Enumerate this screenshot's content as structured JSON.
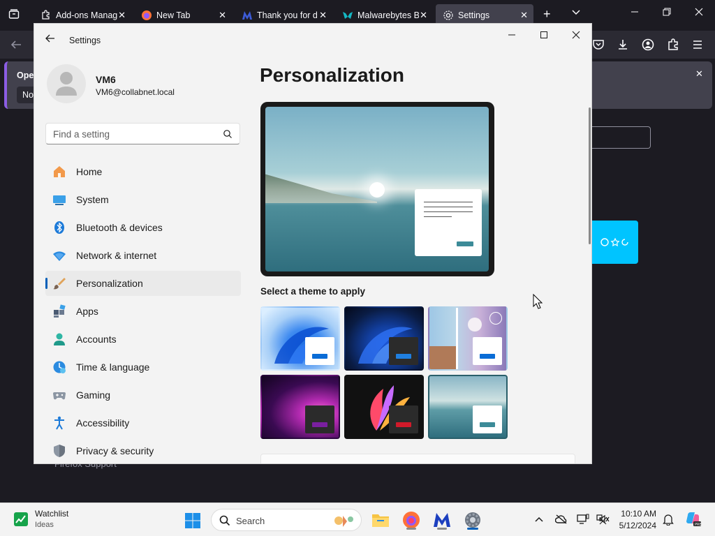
{
  "firefox": {
    "tabs": [
      {
        "label": "Add-ons Manager",
        "icon": "puzzle-icon"
      },
      {
        "label": "New Tab",
        "icon": "firefox-icon"
      },
      {
        "label": "Thank you for d",
        "icon": "malwarebytes-icon"
      },
      {
        "label": "Malwarebytes B",
        "icon": "malwarebytes-teal-icon"
      },
      {
        "label": "Settings",
        "icon": "gear-icon"
      }
    ],
    "notification_label": "Oper",
    "notification_button": "No",
    "support_link": "Firefox Support"
  },
  "settings": {
    "app_title": "Settings",
    "profile": {
      "name": "VM6",
      "email": "VM6@collabnet.local"
    },
    "search_placeholder": "Find a setting",
    "nav": [
      {
        "label": "Home",
        "icon": "home-icon"
      },
      {
        "label": "System",
        "icon": "system-icon"
      },
      {
        "label": "Bluetooth & devices",
        "icon": "bluetooth-icon"
      },
      {
        "label": "Network & internet",
        "icon": "network-icon"
      },
      {
        "label": "Personalization",
        "icon": "brush-icon",
        "selected": true
      },
      {
        "label": "Apps",
        "icon": "apps-icon"
      },
      {
        "label": "Accounts",
        "icon": "accounts-icon"
      },
      {
        "label": "Time & language",
        "icon": "time-icon"
      },
      {
        "label": "Gaming",
        "icon": "gaming-icon"
      },
      {
        "label": "Accessibility",
        "icon": "accessibility-icon"
      },
      {
        "label": "Privacy & security",
        "icon": "shield-icon"
      }
    ],
    "page_title": "Personalization",
    "theme_section_label": "Select a theme to apply",
    "themes": [
      {
        "name": "windows-light",
        "selected": false
      },
      {
        "name": "windows-dark",
        "selected": false
      },
      {
        "name": "windows-spotlight",
        "selected": false
      },
      {
        "name": "glow",
        "selected": false
      },
      {
        "name": "captured-motion",
        "selected": false
      },
      {
        "name": "flow",
        "selected": true
      }
    ]
  },
  "taskbar": {
    "widget_title": "Watchlist",
    "widget_sub": "Ideas",
    "search_placeholder": "Search",
    "time": "10:10 AM",
    "date": "5/12/2024"
  },
  "colors": {
    "accent": "#005fb8",
    "firefox_bg": "#1c1b22",
    "settings_bg": "#f3f3f3"
  }
}
